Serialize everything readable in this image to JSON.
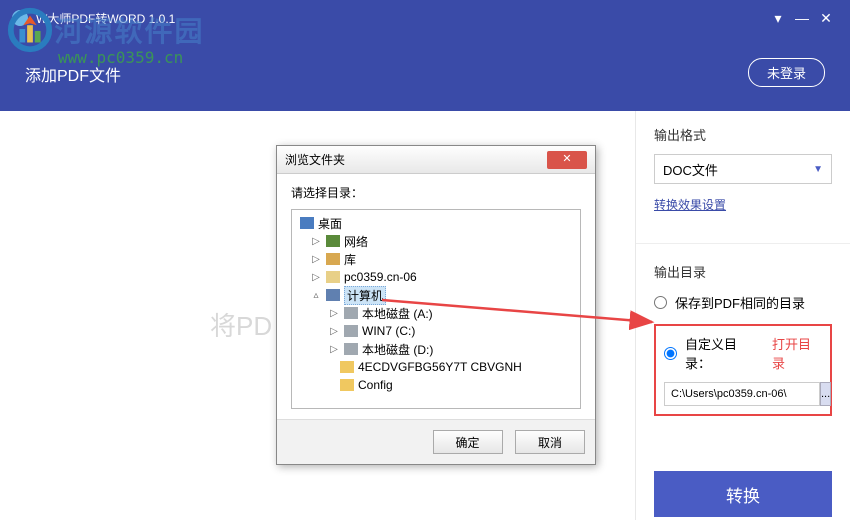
{
  "titlebar": {
    "title": "W大师PDF转WORD 1.0.1"
  },
  "header": {
    "add_label": "添加PDF文件",
    "login_label": "未登录"
  },
  "left": {
    "bg_text": "将PD"
  },
  "right": {
    "format_label": "输出格式",
    "format_value": "DOC文件",
    "effect_link": "转换效果设置",
    "outdir_label": "输出目录",
    "radio_same": "保存到PDF相同的目录",
    "radio_custom": "自定义目录：",
    "open_dir": "打开目录",
    "path_value": "C:\\Users\\pc0359.cn-06\\",
    "convert_label": "转换"
  },
  "dialog": {
    "title": "浏览文件夹",
    "prompt": "请选择目录：",
    "ok": "确定",
    "cancel": "取消",
    "tree": {
      "desktop": "桌面",
      "network": "网络",
      "library": "库",
      "user": "pc0359.cn-06",
      "computer": "计算机",
      "diskA": "本地磁盘 (A:)",
      "diskC": "WIN7 (C:)",
      "diskD": "本地磁盘 (D:)",
      "folder1": "4ECDVGFBG56Y7T CBVGNH",
      "folder2": "Config"
    }
  },
  "watermark": {
    "text": "河源软件园",
    "url": "www.pc0359.cn"
  }
}
